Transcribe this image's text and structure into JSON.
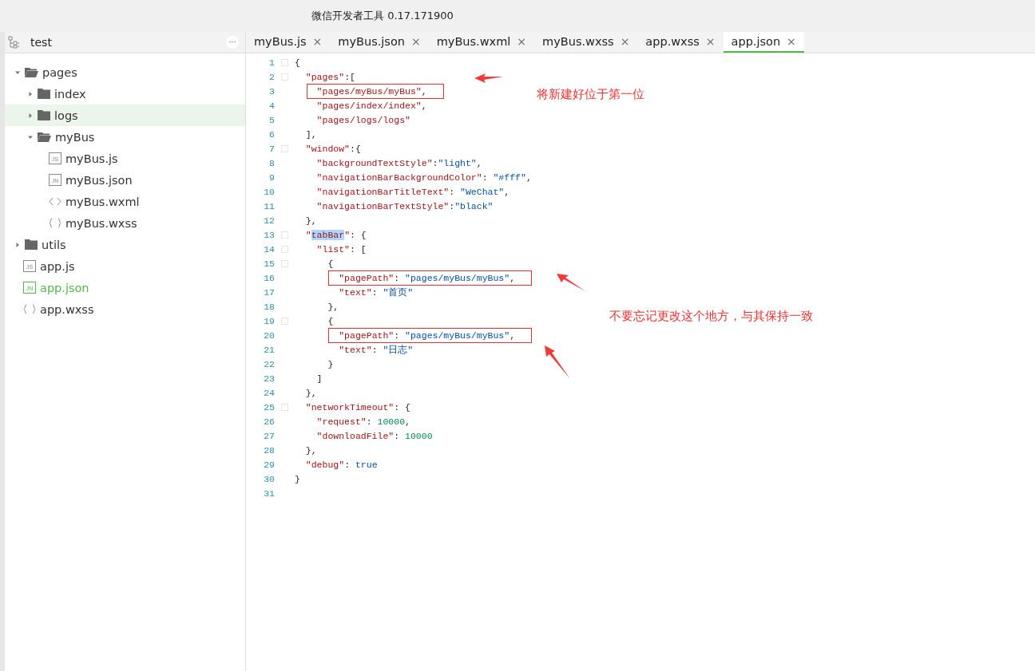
{
  "window": {
    "title": "微信开发者工具 0.17.171900"
  },
  "sidebar": {
    "project": "test",
    "more_button": "···",
    "tree": [
      {
        "kind": "folder",
        "name": "pages",
        "expanded": true,
        "selected": false,
        "active": false,
        "children": [
          {
            "kind": "folder",
            "name": "index",
            "expanded": false,
            "selected": false,
            "active": false
          },
          {
            "kind": "folder",
            "name": "logs",
            "expanded": false,
            "selected": true,
            "active": false
          },
          {
            "kind": "folder",
            "name": "myBus",
            "expanded": true,
            "selected": false,
            "active": false,
            "children": [
              {
                "kind": "js",
                "icon_text": "JS",
                "name": "myBus.js",
                "selected": false,
                "active": false
              },
              {
                "kind": "json",
                "icon_text": "JN",
                "name": "myBus.json",
                "selected": false,
                "active": false
              },
              {
                "kind": "wxml",
                "name": "myBus.wxml",
                "selected": false,
                "active": false
              },
              {
                "kind": "wxss",
                "name": "myBus.wxss",
                "selected": false,
                "active": false
              }
            ]
          }
        ]
      },
      {
        "kind": "folder",
        "name": "utils",
        "expanded": false,
        "selected": false,
        "active": false
      },
      {
        "kind": "js",
        "icon_text": "JS",
        "name": "app.js",
        "selected": false,
        "active": false
      },
      {
        "kind": "json",
        "icon_text": "JN",
        "name": "app.json",
        "selected": false,
        "active": true
      },
      {
        "kind": "wxss",
        "name": "app.wxss",
        "selected": false,
        "active": false
      }
    ]
  },
  "tabs": [
    {
      "label": "myBus.js",
      "close": "×",
      "selected": false
    },
    {
      "label": "myBus.json",
      "close": "×",
      "selected": false
    },
    {
      "label": "myBus.wxml",
      "close": "×",
      "selected": false
    },
    {
      "label": "myBus.wxss",
      "close": "×",
      "selected": false
    },
    {
      "label": "app.wxss",
      "close": "×",
      "selected": false
    },
    {
      "label": "app.json",
      "close": "×",
      "selected": true
    }
  ],
  "editor": {
    "lines": [
      {
        "num": "1",
        "fold": true,
        "boxed": false,
        "tokens": [
          {
            "kind": "punct",
            "text": "{"
          }
        ]
      },
      {
        "num": "2",
        "fold": true,
        "boxed": false,
        "tokens": [
          {
            "kind": "key",
            "text": "  \"pages\""
          },
          {
            "kind": "punct",
            "text": ":["
          }
        ]
      },
      {
        "num": "3",
        "fold": false,
        "boxed": true,
        "tokens": [
          {
            "kind": "key",
            "text": "    \"pages/myBus/myBus\""
          },
          {
            "kind": "punct",
            "text": ","
          }
        ]
      },
      {
        "num": "4",
        "fold": false,
        "boxed": false,
        "tokens": [
          {
            "kind": "key",
            "text": "    \"pages/index/index\""
          },
          {
            "kind": "punct",
            "text": ","
          }
        ]
      },
      {
        "num": "5",
        "fold": false,
        "boxed": false,
        "tokens": [
          {
            "kind": "key",
            "text": "    \"pages/logs/logs\""
          }
        ]
      },
      {
        "num": "6",
        "fold": false,
        "boxed": false,
        "tokens": [
          {
            "kind": "punct",
            "text": "  ],"
          }
        ]
      },
      {
        "num": "7",
        "fold": true,
        "boxed": false,
        "tokens": [
          {
            "kind": "key",
            "text": "  \"window\""
          },
          {
            "kind": "punct",
            "text": ":{"
          }
        ]
      },
      {
        "num": "8",
        "fold": false,
        "boxed": false,
        "tokens": [
          {
            "kind": "key",
            "text": "    \"backgroundTextStyle\""
          },
          {
            "kind": "punct",
            "text": ":"
          },
          {
            "kind": "str",
            "text": "\"light\""
          },
          {
            "kind": "punct",
            "text": ","
          }
        ]
      },
      {
        "num": "9",
        "fold": false,
        "boxed": false,
        "tokens": [
          {
            "kind": "key",
            "text": "    \"navigationBarBackgroundColor\""
          },
          {
            "kind": "punct",
            "text": ": "
          },
          {
            "kind": "str",
            "text": "\"#fff\""
          },
          {
            "kind": "punct",
            "text": ","
          }
        ]
      },
      {
        "num": "10",
        "fold": false,
        "boxed": false,
        "tokens": [
          {
            "kind": "key",
            "text": "    \"navigationBarTitleText\""
          },
          {
            "kind": "punct",
            "text": ": "
          },
          {
            "kind": "str",
            "text": "\"WeChat\""
          },
          {
            "kind": "punct",
            "text": ","
          }
        ]
      },
      {
        "num": "11",
        "fold": false,
        "boxed": false,
        "tokens": [
          {
            "kind": "key",
            "text": "    \"navigationBarTextStyle\""
          },
          {
            "kind": "punct",
            "text": ":"
          },
          {
            "kind": "str",
            "text": "\"black\""
          }
        ]
      },
      {
        "num": "12",
        "fold": false,
        "boxed": false,
        "tokens": [
          {
            "kind": "punct",
            "text": "  },"
          }
        ]
      },
      {
        "num": "13",
        "fold": true,
        "boxed": false,
        "tokens": [
          {
            "kind": "key",
            "text": "  \""
          },
          {
            "kind": "match",
            "text": "tabBar"
          },
          {
            "kind": "key",
            "text": "\""
          },
          {
            "kind": "punct",
            "text": ": {"
          }
        ]
      },
      {
        "num": "14",
        "fold": true,
        "boxed": false,
        "tokens": [
          {
            "kind": "key",
            "text": "    \"list\""
          },
          {
            "kind": "punct",
            "text": ": ["
          }
        ]
      },
      {
        "num": "15",
        "fold": true,
        "boxed": false,
        "tokens": [
          {
            "kind": "punct",
            "text": "      {"
          }
        ]
      },
      {
        "num": "16",
        "fold": false,
        "boxed": true,
        "tokens": [
          {
            "kind": "key",
            "text": "        \"pagePath\""
          },
          {
            "kind": "punct",
            "text": ": "
          },
          {
            "kind": "str",
            "text": "\"pages/myBus/myBus\""
          },
          {
            "kind": "punct",
            "text": ","
          }
        ]
      },
      {
        "num": "17",
        "fold": false,
        "boxed": false,
        "tokens": [
          {
            "kind": "key",
            "text": "        \"text\""
          },
          {
            "kind": "punct",
            "text": ": "
          },
          {
            "kind": "str",
            "text": "\"首页\""
          }
        ]
      },
      {
        "num": "18",
        "fold": false,
        "boxed": false,
        "tokens": [
          {
            "kind": "punct",
            "text": "      },"
          }
        ]
      },
      {
        "num": "19",
        "fold": true,
        "boxed": false,
        "tokens": [
          {
            "kind": "punct",
            "text": "      {"
          }
        ]
      },
      {
        "num": "20",
        "fold": false,
        "boxed": true,
        "tokens": [
          {
            "kind": "key",
            "text": "        \"pagePath\""
          },
          {
            "kind": "punct",
            "text": ": "
          },
          {
            "kind": "str",
            "text": "\"pages/myBus/myBus\""
          },
          {
            "kind": "punct",
            "text": ","
          }
        ]
      },
      {
        "num": "21",
        "fold": false,
        "boxed": false,
        "tokens": [
          {
            "kind": "key",
            "text": "        \"text\""
          },
          {
            "kind": "punct",
            "text": ": "
          },
          {
            "kind": "str",
            "text": "\"日志\""
          }
        ]
      },
      {
        "num": "22",
        "fold": false,
        "boxed": false,
        "tokens": [
          {
            "kind": "punct",
            "text": "      }"
          }
        ]
      },
      {
        "num": "23",
        "fold": false,
        "boxed": false,
        "tokens": [
          {
            "kind": "punct",
            "text": "    ]"
          }
        ]
      },
      {
        "num": "24",
        "fold": false,
        "boxed": false,
        "tokens": [
          {
            "kind": "punct",
            "text": "  },"
          }
        ]
      },
      {
        "num": "25",
        "fold": true,
        "boxed": false,
        "tokens": [
          {
            "kind": "key",
            "text": "  \"networkTimeout\""
          },
          {
            "kind": "punct",
            "text": ": {"
          }
        ]
      },
      {
        "num": "26",
        "fold": false,
        "boxed": false,
        "tokens": [
          {
            "kind": "key",
            "text": "    \"request\""
          },
          {
            "kind": "punct",
            "text": ": "
          },
          {
            "kind": "num",
            "text": "10000"
          },
          {
            "kind": "punct",
            "text": ","
          }
        ]
      },
      {
        "num": "27",
        "fold": false,
        "boxed": false,
        "tokens": [
          {
            "kind": "key",
            "text": "    \"downloadFile\""
          },
          {
            "kind": "punct",
            "text": ": "
          },
          {
            "kind": "num",
            "text": "10000"
          }
        ]
      },
      {
        "num": "28",
        "fold": false,
        "boxed": false,
        "tokens": [
          {
            "kind": "punct",
            "text": "  },"
          }
        ]
      },
      {
        "num": "29",
        "fold": false,
        "boxed": false,
        "tokens": [
          {
            "kind": "key",
            "text": "  \"debug\""
          },
          {
            "kind": "punct",
            "text": ": "
          },
          {
            "kind": "kw",
            "text": "true"
          }
        ]
      },
      {
        "num": "30",
        "fold": false,
        "boxed": false,
        "tokens": [
          {
            "kind": "punct",
            "text": "}"
          }
        ]
      },
      {
        "num": "31",
        "fold": false
      }
    ],
    "notes": [
      "将新建好位于第一位",
      "不要忘记更改这个地方，与其保持一致"
    ]
  }
}
